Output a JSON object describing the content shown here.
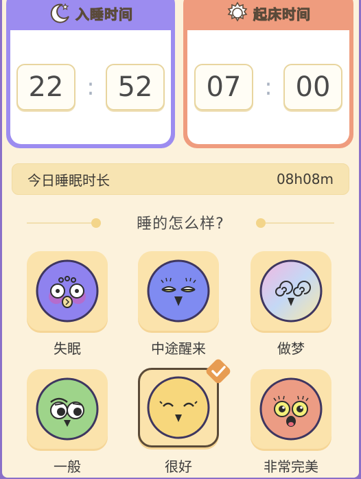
{
  "sleep_time": {
    "title": "入睡时间",
    "hour": "22",
    "minute": "52",
    "separator": ":"
  },
  "wake_time": {
    "title": "起床时间",
    "hour": "07",
    "minute": "00",
    "separator": ":"
  },
  "duration": {
    "label": "今日睡眠时长",
    "value": "08h08m"
  },
  "question": "睡的怎么样?",
  "moods": [
    {
      "label": "失眠",
      "color": "#8f82ef",
      "selected": false
    },
    {
      "label": "中途醒来",
      "color": "#7f8bf1",
      "selected": false
    },
    {
      "label": "做梦",
      "color": "gradient",
      "selected": false
    },
    {
      "label": "一般",
      "color": "#9ed48a",
      "selected": false
    },
    {
      "label": "很好",
      "color": "#f7d77c",
      "selected": true
    },
    {
      "label": "非常完美",
      "color": "#ec9c84",
      "selected": false
    }
  ],
  "colors": {
    "sleep_accent": "#9c8cf0",
    "wake_accent": "#ef9c7e",
    "background": "#fcf2dc",
    "tile": "#fbe3ac",
    "check": "#e79c52"
  }
}
